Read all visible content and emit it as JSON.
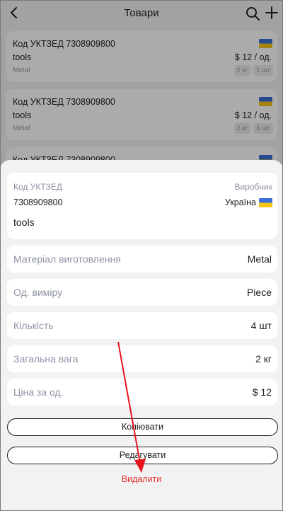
{
  "header": {
    "title": "Товари"
  },
  "background_list": [
    {
      "code": "Код УКТЗЕД 7308909800",
      "name": "tools",
      "material": "Metal",
      "price": "$ 12 / од.",
      "weight": "2 кг",
      "quantity": "1 шт"
    },
    {
      "code": "Код УКТЗЕД 7308909800",
      "name": "tools",
      "material": "Metal",
      "price": "$ 12 / од.",
      "weight": "2 кг",
      "quantity": "4 шт"
    },
    {
      "code": "Код УКТЗЕД 7308909800"
    }
  ],
  "sheet": {
    "code_label": "Код УКТЗЕД",
    "maker_label": "Виробник",
    "code_value": "7308909800",
    "country": "Україна",
    "product_name": "tools",
    "rows": [
      {
        "label": "Матеріал виготовлення",
        "value": "Metal"
      },
      {
        "label": "Од. виміру",
        "value": "Piece"
      },
      {
        "label": "Кількість",
        "value": "4 шт"
      },
      {
        "label": "Загальна вага",
        "value": "2 кг"
      },
      {
        "label": "Ціна за од.",
        "value": "$ 12"
      }
    ],
    "copy_label": "Копіювати",
    "edit_label": "Редагувати",
    "delete_label": "Видалити"
  },
  "colors": {
    "accent_delete": "#e8302a",
    "annotation_arrow": "#e8131b",
    "flag_blue": "#3a6fd8",
    "flag_yellow": "#f5c518"
  },
  "icons": {
    "back": "chevron-left-icon",
    "search": "search-icon",
    "add": "plus-icon",
    "flag": "ukraine-flag-icon"
  }
}
